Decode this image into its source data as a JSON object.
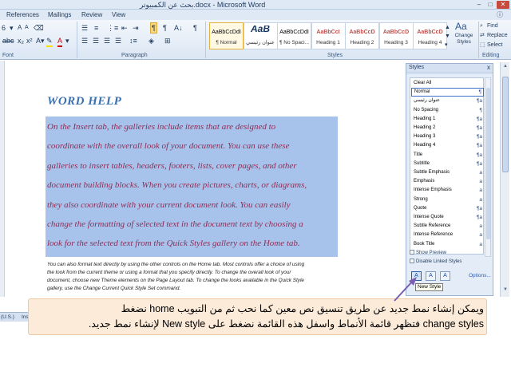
{
  "window": {
    "title": "بحث عن الكمبيوتر.docx - Microsoft Word",
    "min": "–",
    "max": "□",
    "close": "✕"
  },
  "tabs": [
    "References",
    "Mailings",
    "Review",
    "View"
  ],
  "ribbon": {
    "font_size": "6",
    "groups": {
      "font": "Font",
      "paragraph": "Paragraph",
      "styles": "Styles",
      "editing": "Editing"
    },
    "style_gallery": [
      {
        "sample": "AaBbCcDdI",
        "name": "¶ Normal",
        "color": "#000000"
      },
      {
        "sample": "AaB",
        "name": "عنوان رئيسي",
        "color": "#17365d"
      },
      {
        "sample": "AaBbCcDdI",
        "name": "¶ No Spaci...",
        "color": "#000000"
      },
      {
        "sample": "AaBbCcI",
        "name": "Heading 1",
        "color": "#c0504d"
      },
      {
        "sample": "AaBbCcD",
        "name": "Heading 2",
        "color": "#c0504d"
      },
      {
        "sample": "AaBbCcD",
        "name": "Heading 3",
        "color": "#c0504d"
      },
      {
        "sample": "AaBbCcD",
        "name": "Heading 4",
        "color": "#c0504d"
      }
    ],
    "change_styles": "Change Styles",
    "find": "Find",
    "replace": "Replace",
    "select": "Select"
  },
  "document": {
    "heading": "WORD HELP",
    "lines": [
      "On the Insert tab, the galleries include items that are designed to",
      "coordinate with the overall look of your document. You can use these",
      "galleries to insert tables, headers, footers, lists, cover pages, and other",
      "document building blocks. When you create pictures, charts, or diagrams,",
      "they also coordinate with your current document look. You can easily",
      "change the formatting of selected text in the document text by choosing a",
      "look for the selected text from the Quick Styles gallery on the Home tab."
    ],
    "small_lines": [
      "You can also format text directly by using the other controls on the Home tab. Most controls offer a choice of using",
      "the look from the current  theme or using a format that you specify directly.  To change the overall look of your",
      "document, choose new Theme elements on the Page Layout tab. To change the looks available in the Quick Style",
      "gallery, use the Change Current Quick Style Set command."
    ]
  },
  "styles_pane": {
    "title": "Styles",
    "close": "x",
    "items": [
      {
        "label": "Clear All",
        "glyph": ""
      },
      {
        "label": "Normal",
        "glyph": "¶"
      },
      {
        "label": "عنوان رئيسي",
        "glyph": "¶a"
      },
      {
        "label": "No Spacing",
        "glyph": "¶"
      },
      {
        "label": "Heading 1",
        "glyph": "¶a"
      },
      {
        "label": "Heading 2",
        "glyph": "¶a"
      },
      {
        "label": "Heading 3",
        "glyph": "¶a"
      },
      {
        "label": "Heading 4",
        "glyph": "¶a"
      },
      {
        "label": "Title",
        "glyph": "¶a"
      },
      {
        "label": "Subtitle",
        "glyph": "¶a"
      },
      {
        "label": "Subtle Emphasis",
        "glyph": "a"
      },
      {
        "label": "Emphasis",
        "glyph": "a"
      },
      {
        "label": "Intense Emphasis",
        "glyph": "a"
      },
      {
        "label": "Strong",
        "glyph": "a"
      },
      {
        "label": "Quote",
        "glyph": "¶a"
      },
      {
        "label": "Intense Quote",
        "glyph": "¶a"
      },
      {
        "label": "Subtle Reference",
        "glyph": "a"
      },
      {
        "label": "Intense Reference",
        "glyph": "a"
      },
      {
        "label": "Book Title",
        "glyph": "a"
      }
    ],
    "selected_index": 1,
    "show_preview": "Show Preview",
    "disable_linked": "Disable Linked Styles",
    "options": "Options...",
    "tooltip": "New Style"
  },
  "status": {
    "left": "(U.S.)",
    "ins": "Ins"
  },
  "callout": {
    "line1": "ويمكن إنشاء نمط جديد عن طريق تنسيق نص معين كما نحب ثم من التبويب home نضغط",
    "line2": "change styles فتظهر قائمة الأنماط واسفل هذه القائمة نضغط على New style لإنشاء نمط جديد."
  }
}
